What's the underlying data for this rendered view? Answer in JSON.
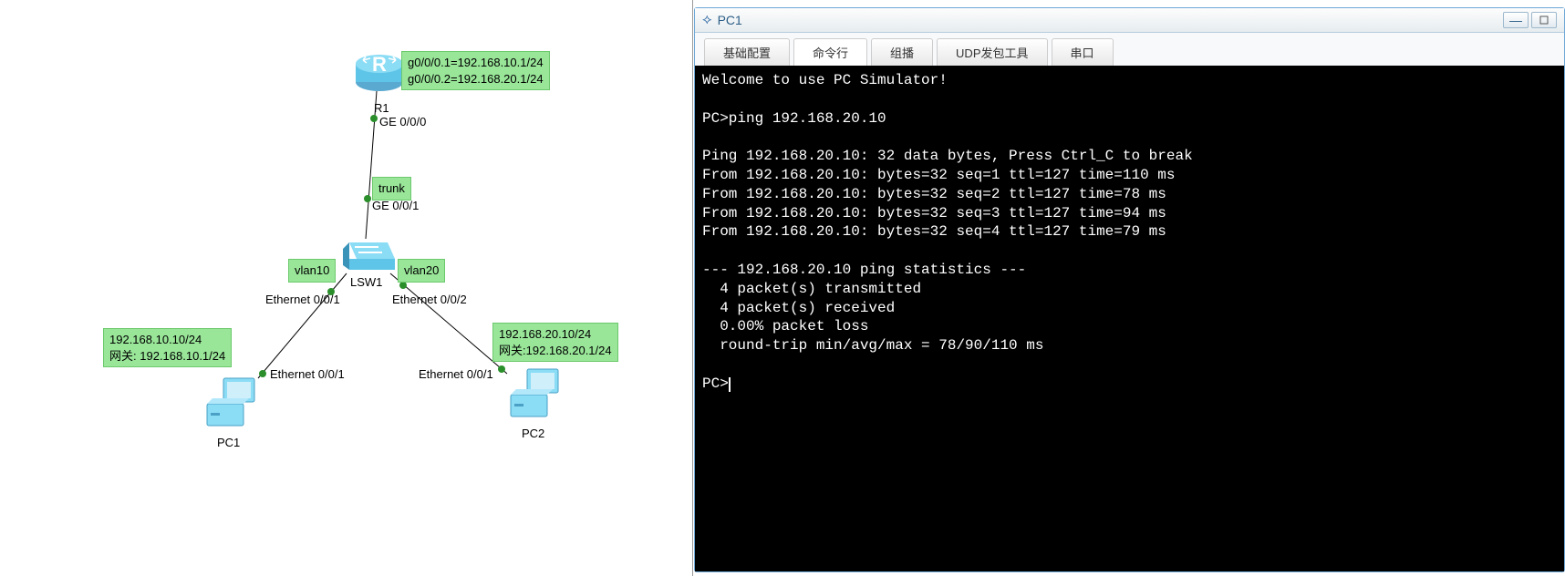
{
  "topology": {
    "router": {
      "name": "R1",
      "note1": "g0/0/0.1=192.168.10.1/24",
      "note2": "g0/0/0.2=192.168.20.1/24",
      "port_down": "GE 0/0/0"
    },
    "trunk_label": "trunk",
    "switch": {
      "name": "LSW1",
      "port_up": "GE 0/0/1",
      "vlan_left": "vlan10",
      "vlan_right": "vlan20",
      "port_left": "Ethernet 0/0/1",
      "port_right": "Ethernet 0/0/2"
    },
    "pc1": {
      "name": "PC1",
      "port": "Ethernet 0/0/1",
      "ip": "192.168.10.10/24",
      "gw_label": "网关:",
      "gw": "192.168.10.1/24"
    },
    "pc2": {
      "name": "PC2",
      "port": "Ethernet 0/0/1",
      "ip": "192.168.20.10/24",
      "gw_label": "网关:",
      "gw": "192.168.20.1/24"
    }
  },
  "terminal": {
    "title": "PC1",
    "tabs": [
      "基础配置",
      "命令行",
      "组播",
      "UDP发包工具",
      "串口"
    ],
    "active_tab": 1,
    "lines": [
      "Welcome to use PC Simulator!",
      "",
      "PC>ping 192.168.20.10",
      "",
      "Ping 192.168.20.10: 32 data bytes, Press Ctrl_C to break",
      "From 192.168.20.10: bytes=32 seq=1 ttl=127 time=110 ms",
      "From 192.168.20.10: bytes=32 seq=2 ttl=127 time=78 ms",
      "From 192.168.20.10: bytes=32 seq=3 ttl=127 time=94 ms",
      "From 192.168.20.10: bytes=32 seq=4 ttl=127 time=79 ms",
      "",
      "--- 192.168.20.10 ping statistics ---",
      "  4 packet(s) transmitted",
      "  4 packet(s) received",
      "  0.00% packet loss",
      "  round-trip min/avg/max = 78/90/110 ms",
      "",
      "PC>"
    ]
  },
  "icons": {
    "minimize": "—"
  }
}
